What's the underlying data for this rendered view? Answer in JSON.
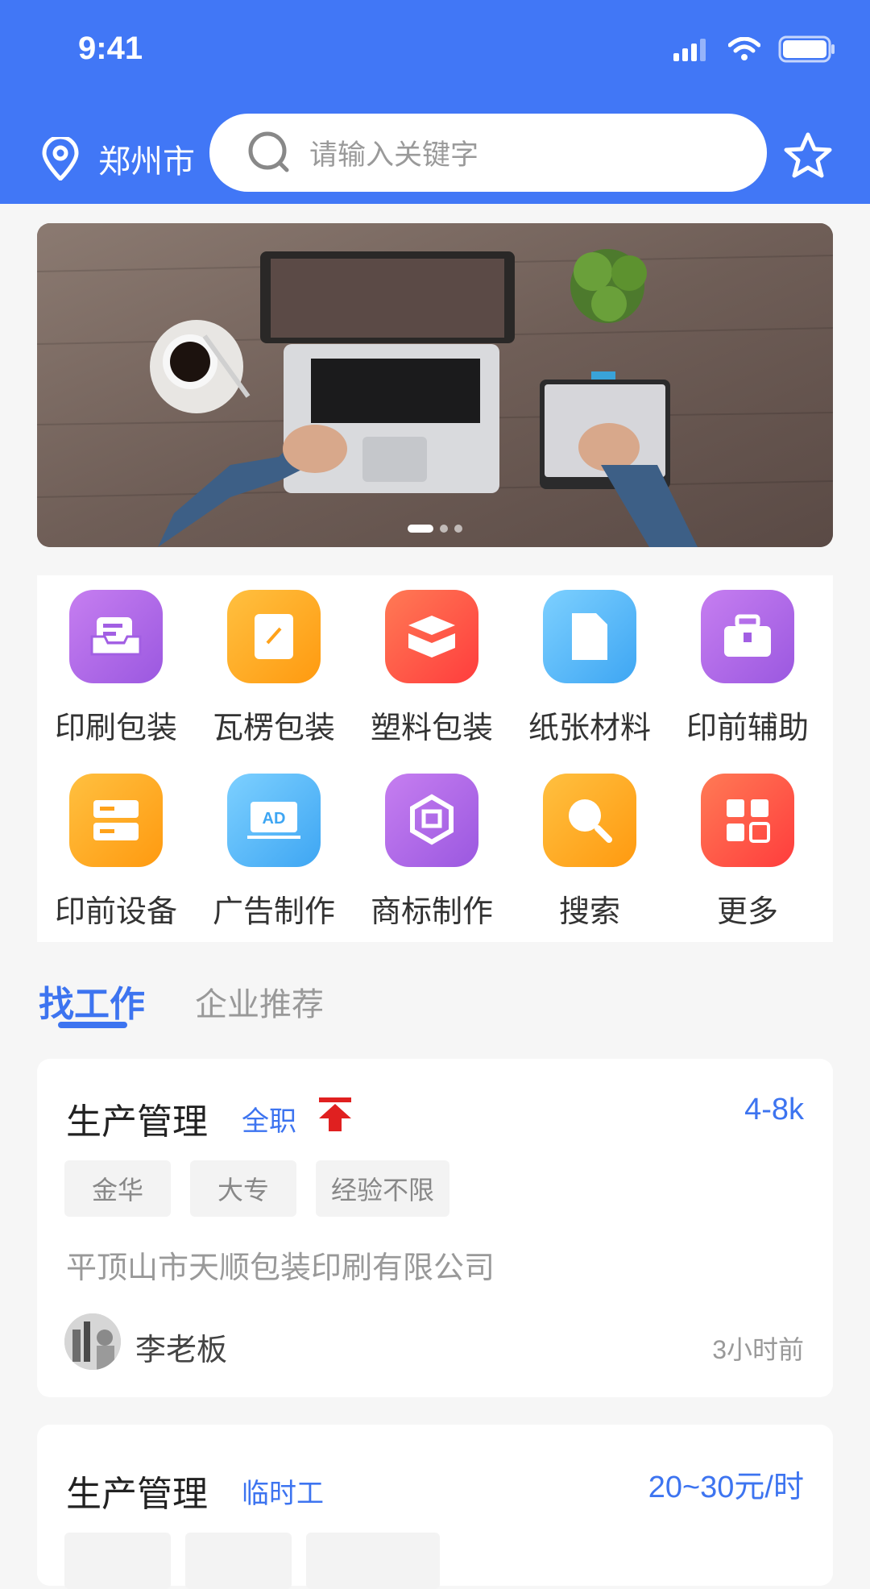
{
  "status": {
    "time": "9:41"
  },
  "header": {
    "city": "郑州市",
    "search_placeholder": "请输入关键字"
  },
  "categories": [
    {
      "label": "印刷包装",
      "icon": "printer-tray-icon",
      "color": "#a25fe3"
    },
    {
      "label": "瓦楞包装",
      "icon": "note-pad-icon",
      "color": "#ffa21a"
    },
    {
      "label": "塑料包装",
      "icon": "box-icon",
      "color": "#ff5645"
    },
    {
      "label": "纸张材料",
      "icon": "paper-icon",
      "color": "#4fb4f7"
    },
    {
      "label": "印前辅助",
      "icon": "toolbox-icon",
      "color": "#a25fe3"
    },
    {
      "label": "印前设备",
      "icon": "server-icon",
      "color": "#ffa21a"
    },
    {
      "label": "广告制作",
      "icon": "ad-screen-icon",
      "color": "#4fb4f7"
    },
    {
      "label": "商标制作",
      "icon": "brand-logo-icon",
      "color": "#a25fe3"
    },
    {
      "label": "搜索",
      "icon": "search-icon",
      "color": "#ffa21a"
    },
    {
      "label": "更多",
      "icon": "grid-more-icon",
      "color": "#ff5645"
    }
  ],
  "tabs": [
    {
      "label": "找工作",
      "active": true
    },
    {
      "label": "企业推荐",
      "active": false
    }
  ],
  "jobs": [
    {
      "title": "生产管理",
      "type": "全职",
      "salary": "4-8k",
      "tags": [
        "金华",
        "大专",
        "经验不限"
      ],
      "company": "平顶山市天顺包装印刷有限公司",
      "boss": "李老板",
      "time": "3小时前"
    },
    {
      "title": "生产管理",
      "type": "临时工",
      "salary": "20~30元/时"
    }
  ]
}
